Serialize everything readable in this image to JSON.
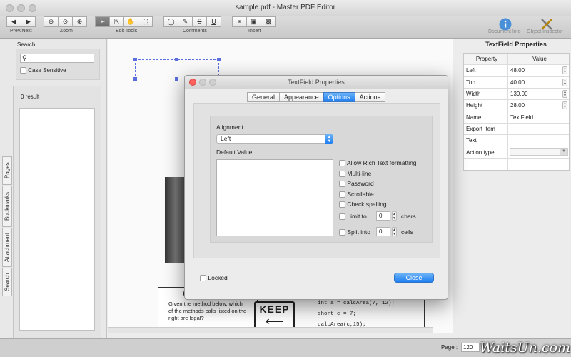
{
  "window": {
    "title": "sample.pdf - Master PDF Editor"
  },
  "toolbar": {
    "groups": {
      "prevnext": "Prev/Next",
      "zoom": "Zoom",
      "edit_tools": "Edit Tools",
      "comments": "Comments",
      "insert": "Insert"
    },
    "document_info": "Document Info",
    "object_inspector": "Object Inspector"
  },
  "left_panel": {
    "search_label": "Search",
    "search_placeholder": "",
    "case_sensitive": "Case Sensitive",
    "result_count": "0 result",
    "tabs": [
      "Pages",
      "Bookmarks",
      "Attachment",
      "Search"
    ]
  },
  "right_panel": {
    "title": "TextField Properties",
    "col_property": "Property",
    "col_value": "Value",
    "rows": [
      {
        "k": "Left",
        "v": "48.00"
      },
      {
        "k": "Top",
        "v": "40.00"
      },
      {
        "k": "Width",
        "v": "139.00"
      },
      {
        "k": "Height",
        "v": "28.00"
      },
      {
        "k": "Name",
        "v": "TextField"
      },
      {
        "k": "Export Item",
        "v": ""
      },
      {
        "k": "Text",
        "v": ""
      },
      {
        "k": "Action type",
        "v": ""
      }
    ]
  },
  "pdf": {
    "heading": "What's legal?",
    "body": "Given the method below, which of the methods calls listed on the right are legal?",
    "sign_text": "KEEP",
    "code": [
      "int a = calcArea(7, 12);",
      "short c = 7;",
      "calcArea(c,15);"
    ]
  },
  "dialog": {
    "title": "TextField Properties",
    "tabs": [
      "General",
      "Appearance",
      "Options",
      "Actions"
    ],
    "active_tab": "Options",
    "alignment_label": "Alignment",
    "alignment_value": "Left",
    "default_value_label": "Default Value",
    "options": {
      "rich_text": "Allow Rich Text formatting",
      "multiline": "Multi-line",
      "password": "Password",
      "scrollable": "Scrollable",
      "check_spelling": "Check spelling",
      "limit_to": "Limit to",
      "limit_value": "0",
      "chars": "chars",
      "split_into": "Split into",
      "split_value": "0",
      "cells": "cells"
    },
    "locked": "Locked",
    "close_button": "Close"
  },
  "status": {
    "page_label": "Page :",
    "page_value": "120"
  },
  "watermark": "WaitsUn.com",
  "colors": {
    "accent": "#1f7ff0",
    "dialog_bg": "#ececec"
  }
}
